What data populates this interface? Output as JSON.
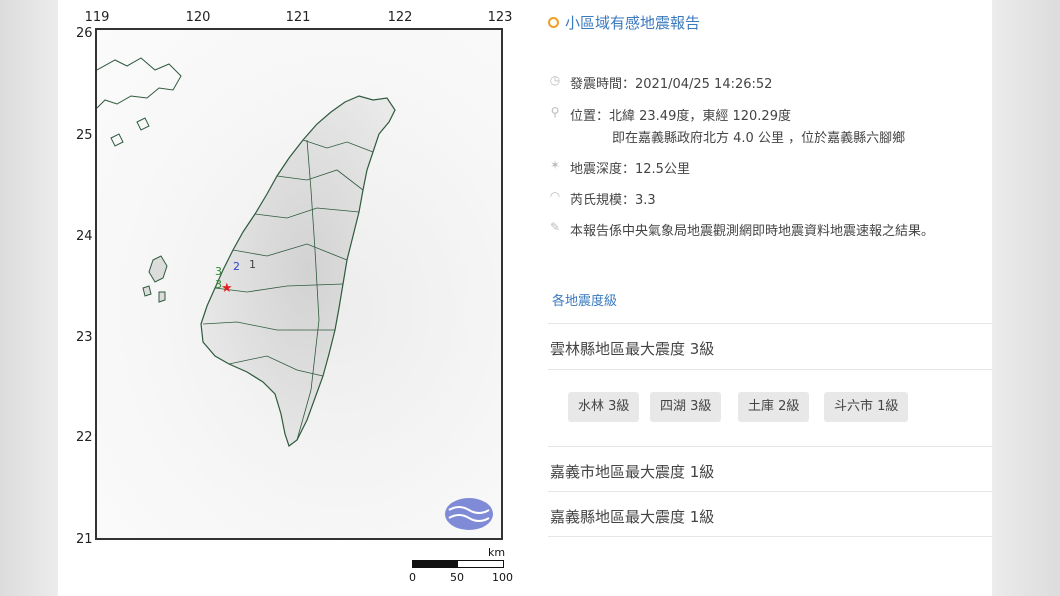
{
  "map": {
    "lon_labels": [
      "119",
      "120",
      "121",
      "122",
      "123"
    ],
    "lat_labels": [
      "26",
      "25",
      "24",
      "23",
      "22",
      "21"
    ],
    "intensity_marks": [
      {
        "label": "3",
        "color": "#2e8b2e"
      },
      {
        "label": "2",
        "color": "#3344cc"
      },
      {
        "label": "1",
        "color": "#444444"
      },
      {
        "label": "3",
        "color": "#2e8b2e"
      }
    ],
    "scale": {
      "unit": "km",
      "ticks": [
        "0",
        "50",
        "100"
      ]
    }
  },
  "report": {
    "title": "小區域有感地震報告",
    "time": "發震時間：2021/04/25 14:26:52",
    "location": "位置：北緯 23.49度，東經 120.29度",
    "location_detail": "即在嘉義縣政府北方 4.0 公里 ，位於嘉義縣六腳鄉",
    "depth": "地震深度：12.5公里",
    "magnitude": "芮氏規模：3.3",
    "note": "本報告係中央氣象局地震觀測網即時地震資料地震速報之結果。",
    "section_label": "各地震度級",
    "regions": [
      {
        "title": "雲林縣地區最大震度 3級",
        "stations": [
          "水林 3級",
          "四湖 3級",
          "土庫 2級",
          "斗六市 1級"
        ]
      },
      {
        "title": "嘉義市地區最大震度 1級",
        "stations": []
      },
      {
        "title": "嘉義縣地區最大震度 1級",
        "stations": []
      }
    ]
  },
  "colors": {
    "accent": "#3a7abf",
    "title_icon": "#f0a020",
    "epicenter": "#e02020"
  }
}
